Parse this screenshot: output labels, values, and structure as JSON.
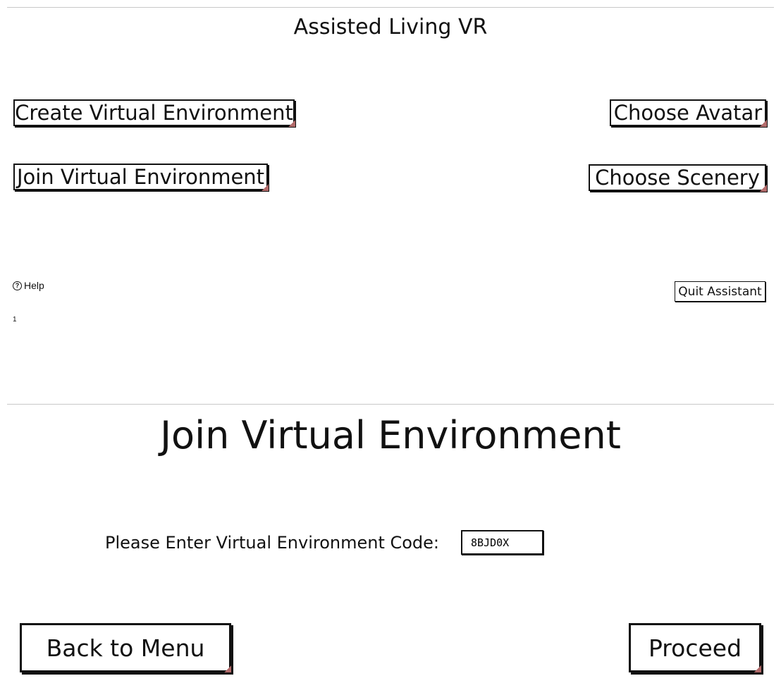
{
  "menu": {
    "title": "Assisted Living VR",
    "create_label": "Create Virtual Environment",
    "join_label": "Join Virtual Environment",
    "avatar_label": "Choose Avatar",
    "scenery_label": "Choose Scenery",
    "help_label": "Help",
    "help_icon": "?",
    "quit_label": "Quit Assistant",
    "page_number": "1"
  },
  "join": {
    "title": "Join Virtual Environment",
    "code_label": "Please Enter Virtual Environment Code:",
    "code_value": "8BJD0X",
    "back_label": "Back to Menu",
    "proceed_label": "Proceed"
  },
  "colors": {
    "border": "#111111",
    "corner_accent": "#b26a6a",
    "panel_divider": "#c9c9c9"
  }
}
